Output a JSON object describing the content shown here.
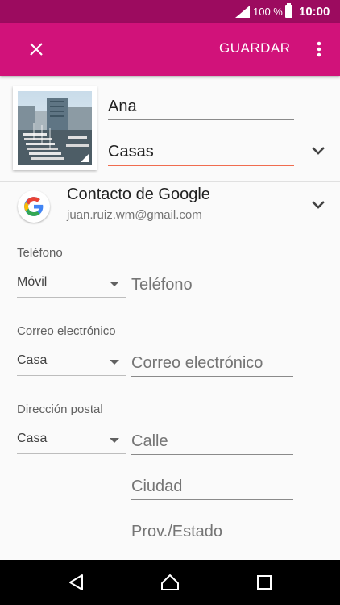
{
  "status_bar": {
    "battery": "100 %",
    "time": "10:00"
  },
  "app_bar": {
    "save_label": "GUARDAR"
  },
  "contact": {
    "first_name": "Ana",
    "last_name": "Casas"
  },
  "account": {
    "title": "Contacto de Google",
    "email": "juan.ruiz.wm@gmail.com"
  },
  "phone": {
    "label": "Teléfono",
    "type": "Móvil",
    "placeholder": "Teléfono"
  },
  "email": {
    "label": "Correo electrónico",
    "type": "Casa",
    "placeholder": "Correo electrónico"
  },
  "address": {
    "label": "Dirección postal",
    "type": "Casa",
    "street_placeholder": "Calle",
    "city_placeholder": "Ciudad",
    "state_placeholder": "Prov./Estado"
  },
  "colors": {
    "status_bar": "#9c0b5f",
    "app_bar": "#d1127a",
    "active_underline": "#f06c4f"
  }
}
